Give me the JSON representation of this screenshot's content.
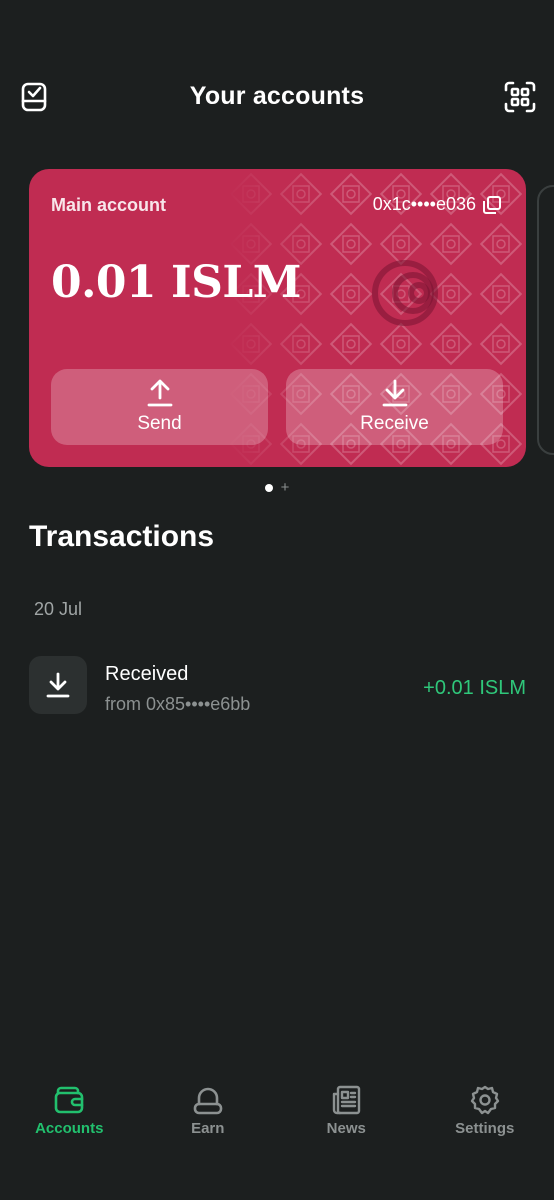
{
  "header": {
    "title": "Your accounts",
    "left_icon": "clipboard-check-icon",
    "right_icon": "qr-scan-icon"
  },
  "card": {
    "name": "Main account",
    "address": "0x1c••••e036",
    "balance": "0.01 ISLM",
    "send_label": "Send",
    "receive_label": "Receive",
    "color": "#c02c52"
  },
  "pager": {
    "plus": "+"
  },
  "transactions": {
    "heading": "Transactions",
    "groups": [
      {
        "date": "20 Jul",
        "items": [
          {
            "type": "Received",
            "from": "from 0x85••••e6bb",
            "amount": "+0.01 ISLM",
            "icon": "download-icon"
          }
        ]
      }
    ]
  },
  "nav": {
    "items": [
      {
        "label": "Accounts",
        "icon": "wallet-icon",
        "active": true
      },
      {
        "label": "Earn",
        "icon": "piggy-icon",
        "active": false
      },
      {
        "label": "News",
        "icon": "newspaper-icon",
        "active": false
      },
      {
        "label": "Settings",
        "icon": "gear-icon",
        "active": false
      }
    ]
  },
  "colors": {
    "background": "#1c1f1f",
    "card": "#c02c52",
    "positive": "#2fc77a",
    "active_nav": "#22c06e",
    "muted": "#8c9191"
  }
}
